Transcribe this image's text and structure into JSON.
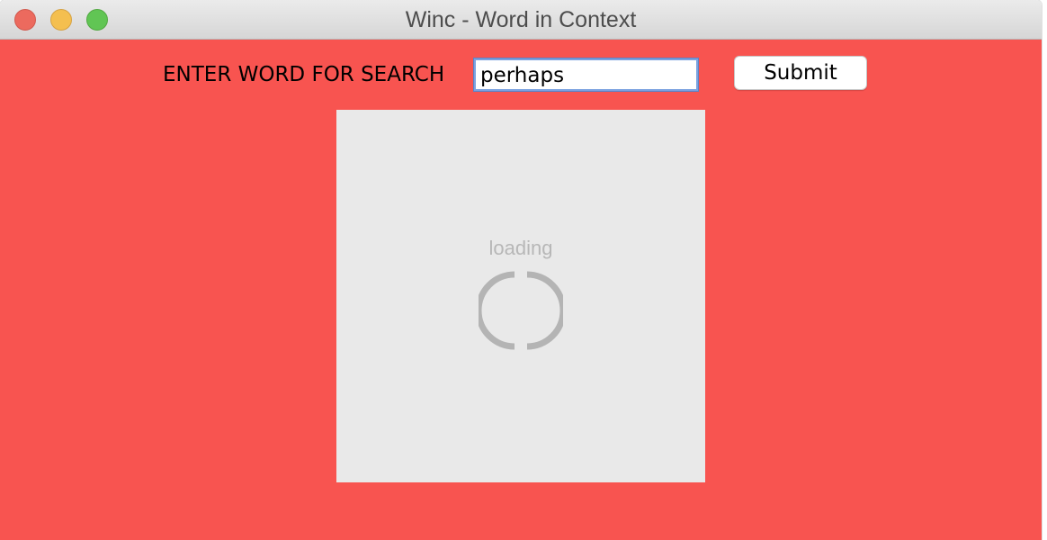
{
  "window": {
    "title": "Winc - Word in Context"
  },
  "search": {
    "label": "ENTER WORD FOR SEARCH",
    "value": "perhaps",
    "submit_label": "Submit"
  },
  "viewer": {
    "loading_text": "loading",
    "spinner_icon": "loading-spinner-icon"
  },
  "colors": {
    "background": "#f85450",
    "panel": "#e9e9e9"
  }
}
